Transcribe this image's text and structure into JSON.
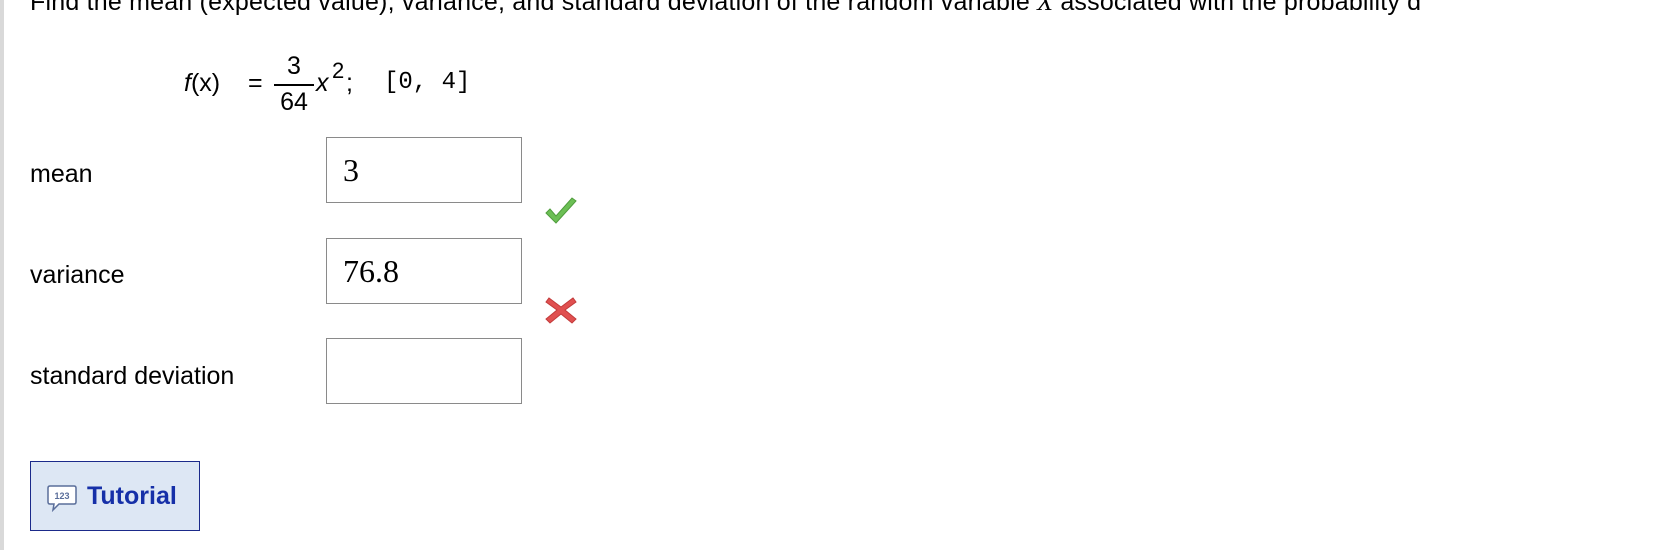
{
  "problem": {
    "intro_start": "Find the mean (expected value), variance, and standard deviation of the random variable ",
    "intro_var": "X",
    "intro_end": " associated with the probability d"
  },
  "formula": {
    "lhs_f": "f",
    "lhs_paren": "(x)",
    "equals": "=",
    "numerator": "3",
    "denominator": "64",
    "variable": "x",
    "exponent": "2",
    "semicolon": ";",
    "interval": "[0, 4]"
  },
  "rows": [
    {
      "label": "mean",
      "value": "3",
      "status": "correct"
    },
    {
      "label": "variance",
      "value": "76.8",
      "status": "incorrect"
    },
    {
      "label": "standard deviation",
      "value": "",
      "status": "none"
    }
  ],
  "tutorial": {
    "icon": "tutorial-icon",
    "label": "Tutorial"
  },
  "colors": {
    "correct": "#6cbf55",
    "incorrect": "#e05050",
    "link": "#1630a8",
    "button_bg": "#dde7f4"
  }
}
